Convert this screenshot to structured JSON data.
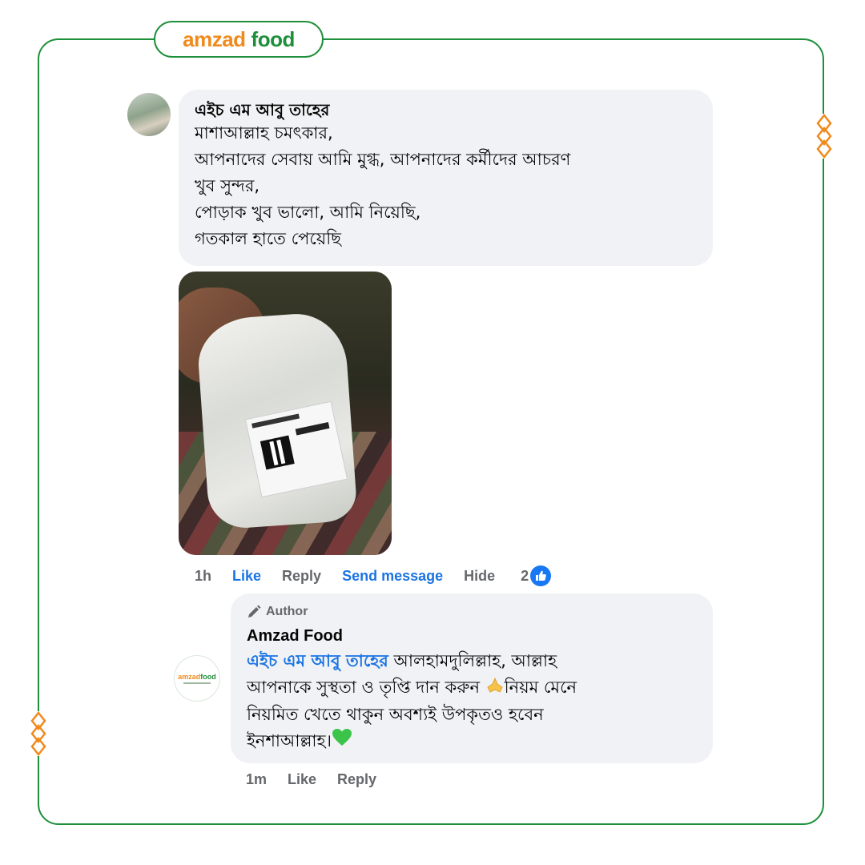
{
  "brand": {
    "part1": "amzad",
    "part2": "food"
  },
  "comment": {
    "author": "এইচ এম আবু তাহের",
    "lines": [
      "মাশাআল্লাহ চমৎকার,",
      "আপনাদের সেবায় আমি মুগ্ধ, আপনাদের কর্মীদের আচরণ",
      "খুব সুন্দর,",
      "পোড়াক খুব ভালো, আমি নিয়েছি,",
      "গতকাল হাতে পেয়েছি"
    ],
    "actions": {
      "time": "1h",
      "like": "Like",
      "reply": "Reply",
      "send_message": "Send message",
      "hide": "Hide",
      "reaction_count": "2"
    }
  },
  "reply": {
    "author_tag": "Author",
    "page_name": "Amzad Food",
    "avatar_logo": {
      "part1": "amzad",
      "part2": "food"
    },
    "mention": "এইচ এম আবু তাহের",
    "line1_rest": " আলহামদুলিল্লাহ, আল্লাহ",
    "line2_a": "আপনাকে সুস্থতা ও তৃপ্তি দান করুন ",
    "line2_b": "নিয়ম মেনে",
    "line3": "নিয়মিত খেতে থাকুন অবশ্যই উপকৃতও হবেন",
    "line4": "ইনশাআল্লাহ।",
    "actions": {
      "time": "1m",
      "like": "Like",
      "reply": "Reply"
    }
  },
  "colors": {
    "brand_green": "#1e8f3a",
    "brand_orange": "#f08a1c",
    "fb_blue": "#1b74e4",
    "bubble_bg": "#f0f2f5"
  },
  "icons": [
    "like-thumb-icon",
    "pencil-icon",
    "praying-hands-emoji",
    "green-heart-emoji",
    "diamond-decoration-icon"
  ]
}
